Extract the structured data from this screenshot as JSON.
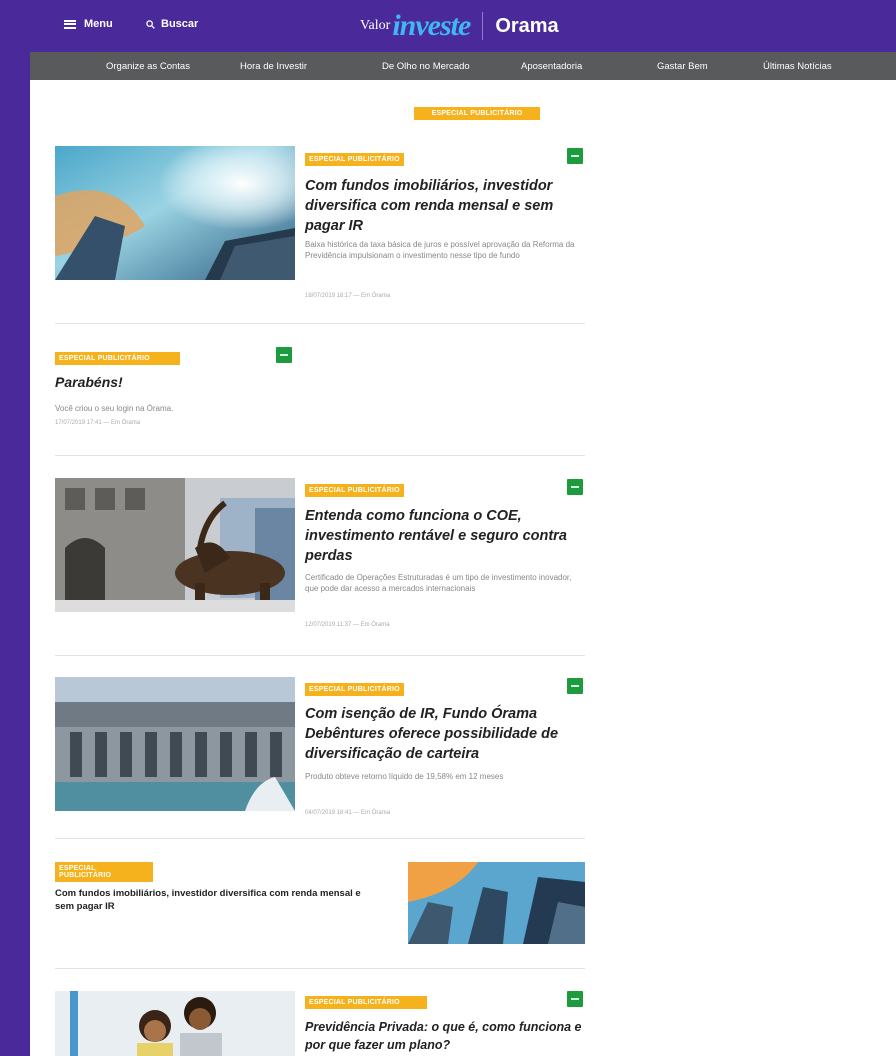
{
  "header": {
    "menu_label": "Menu",
    "search_label": "Buscar",
    "logo_valor": "Valor",
    "logo_investe": "investe",
    "logo_orama": "Orama"
  },
  "nav": [
    "Organize as Contas",
    "Hora de Investir",
    "De Olho no Mercado",
    "Aposentadoria",
    "Gastar Bem",
    "Últimas Notícias"
  ],
  "section_tag": "ESPECIAL PUBLICITÁRIO",
  "articles": [
    {
      "tag": "ESPECIAL PUBLICITÁRIO",
      "title": "Com fundos imobiliários, investidor diversifica com renda mensal e sem pagar IR",
      "desc": "Baixa histórica da taxa básica de juros e possível aprovação da Reforma da Previdência impulsionam o investimento nesse tipo de fundo",
      "meta": "18/07/2019 18:17 — Em Órama"
    },
    {
      "tag": "ESPECIAL PUBLICITÁRIO",
      "title": "Parabéns!",
      "desc": "Você criou o seu login na Órama.",
      "meta": "17/07/2019 17:41 — Em Órama"
    },
    {
      "tag": "ESPECIAL PUBLICITÁRIO",
      "title": "Entenda como funciona o COE, investimento rentável e seguro contra perdas",
      "desc": "Certificado de Operações Estruturadas é um tipo de investimento inovador, que pode dar acesso a mercados internacionais",
      "meta": "12/07/2019 11:37 — Em Órama"
    },
    {
      "tag": "ESPECIAL PUBLICITÁRIO",
      "title": "Com isenção de IR, Fundo Órama Debêntures oferece possibilidade de diversificação de carteira",
      "desc": "Produto obteve retorno líquido de 19,58% em 12 meses",
      "meta": "04/07/2019 18:41 — Em Órama"
    },
    {
      "tag": "ESPECIAL PUBLICITÁRIO",
      "title": "Com fundos imobiliários, investidor diversifica com renda mensal e sem pagar IR"
    },
    {
      "tag": "ESPECIAL PUBLICITÁRIO",
      "title": "Previdência Privada: o que é, como funciona e por que fazer um plano?"
    }
  ],
  "colors": {
    "brand_purple": "#4a2a9a",
    "nav_gray": "#595a5c",
    "tag_yellow": "#f5b21c",
    "badge_green": "#1e9b3c",
    "logo_blue": "#3fb7f0"
  }
}
